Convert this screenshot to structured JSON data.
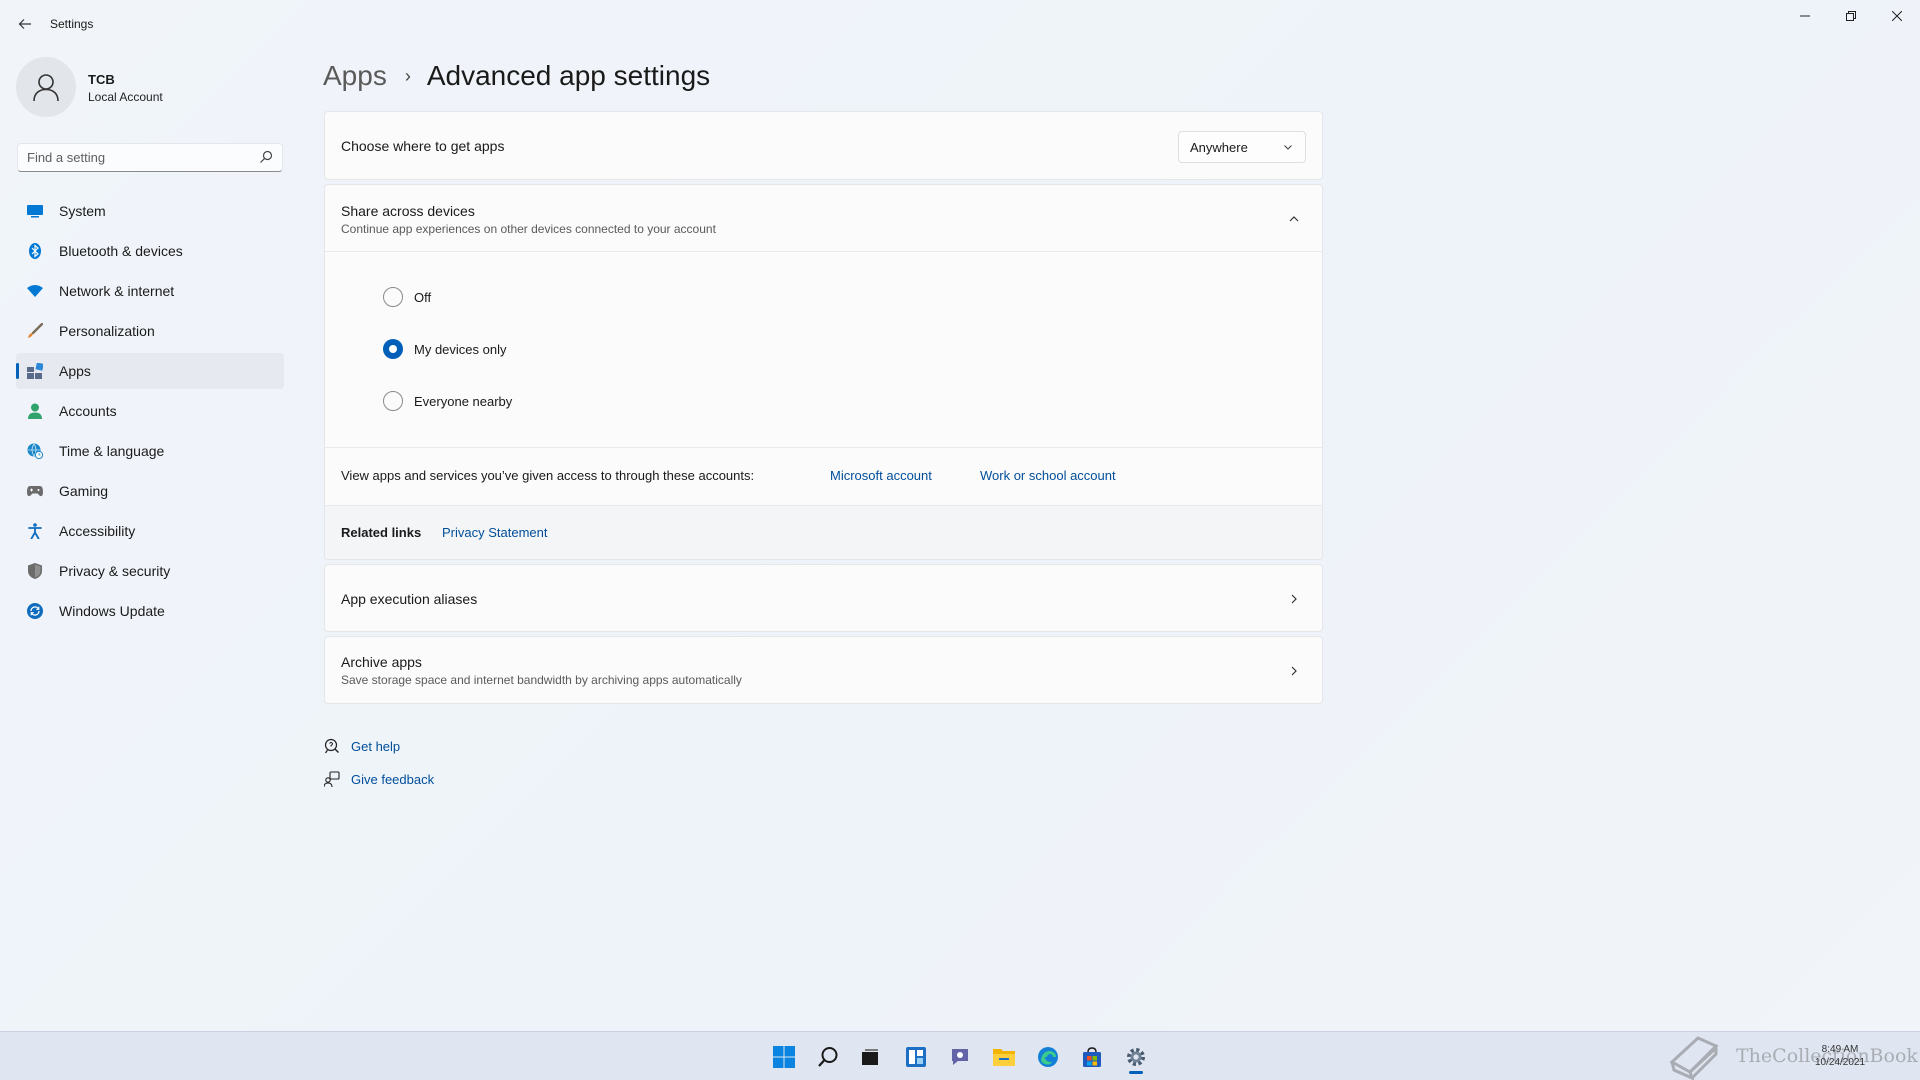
{
  "window": {
    "title": "Settings"
  },
  "user": {
    "name": "TCB",
    "account_type": "Local Account"
  },
  "search": {
    "placeholder": "Find a setting"
  },
  "nav": {
    "items": [
      {
        "label": "System",
        "icon": "system-icon",
        "color": "#0078d4"
      },
      {
        "label": "Bluetooth & devices",
        "icon": "bluetooth-icon",
        "color": "#0078d4"
      },
      {
        "label": "Network & internet",
        "icon": "wifi-icon",
        "color": "#0078d4"
      },
      {
        "label": "Personalization",
        "icon": "brush-icon",
        "color": "#c47a3a"
      },
      {
        "label": "Apps",
        "icon": "apps-icon",
        "color": "#5a6b8a",
        "active": true
      },
      {
        "label": "Accounts",
        "icon": "accounts-icon",
        "color": "#2fa36b"
      },
      {
        "label": "Time & language",
        "icon": "globe-clock-icon",
        "color": "#1a86c7"
      },
      {
        "label": "Gaming",
        "icon": "gamepad-icon",
        "color": "#6b6b6b"
      },
      {
        "label": "Accessibility",
        "icon": "accessibility-icon",
        "color": "#0f6cbd"
      },
      {
        "label": "Privacy & security",
        "icon": "shield-icon",
        "color": "#6b6b6b"
      },
      {
        "label": "Windows Update",
        "icon": "update-icon",
        "color": "#0f6cbd"
      }
    ]
  },
  "breadcrumb": {
    "parent": "Apps",
    "separator": "›",
    "current": "Advanced app settings"
  },
  "choose_apps": {
    "label": "Choose where to get apps",
    "value": "Anywhere"
  },
  "share": {
    "title": "Share across devices",
    "description": "Continue app experiences on other devices connected to your account",
    "options": [
      {
        "label": "Off",
        "checked": false
      },
      {
        "label": "My devices only",
        "checked": true
      },
      {
        "label": "Everyone nearby",
        "checked": false
      }
    ]
  },
  "accounts_row": {
    "text": "View apps and services you’ve given access to through these accounts:",
    "link1": "Microsoft account",
    "link2": "Work or school account"
  },
  "related": {
    "label": "Related links",
    "link": "Privacy Statement"
  },
  "aliases": {
    "title": "App execution aliases"
  },
  "archive": {
    "title": "Archive apps",
    "description": "Save storage space and internet bandwidth by archiving apps automatically"
  },
  "help": {
    "get_help": "Get help",
    "give_feedback": "Give feedback"
  },
  "taskbar": {
    "apps": [
      "start-icon",
      "search-icon",
      "task-view-icon",
      "widgets-icon",
      "chat-icon",
      "file-explorer-icon",
      "edge-icon",
      "store-icon",
      "settings-icon"
    ],
    "watermark": "TheCollectionBook",
    "time": "8:49 AM",
    "date": "10/24/2021"
  },
  "colors": {
    "accent": "#005fb8",
    "link": "#004e9a"
  }
}
